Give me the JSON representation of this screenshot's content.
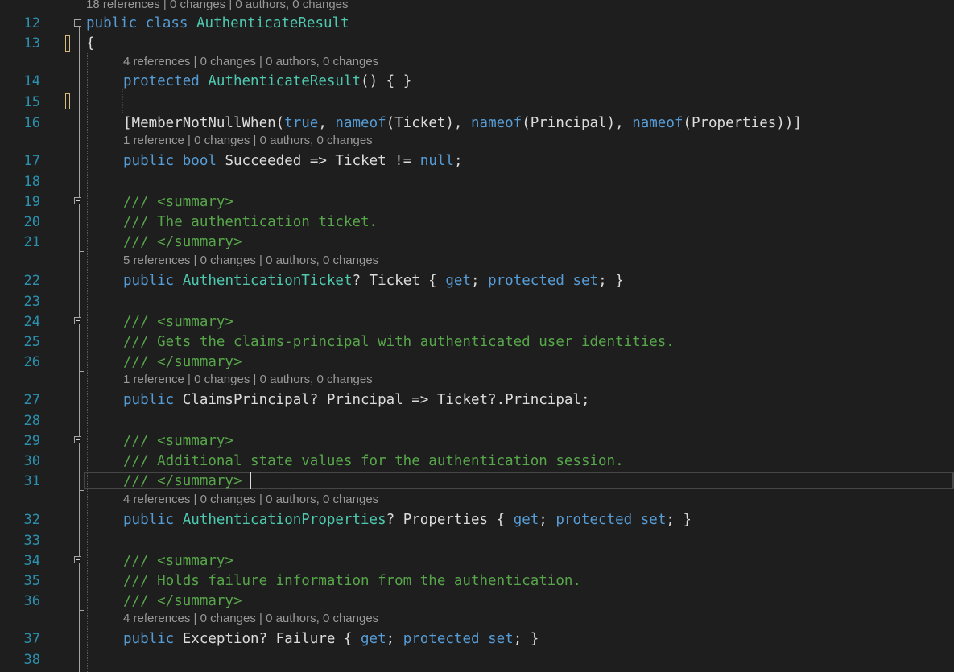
{
  "editor": {
    "lens_top": "18 references | 0 changes | 0 authors, 0 changes",
    "lines": [
      {
        "num": "12"
      },
      {
        "num": "13"
      },
      {
        "num": "14"
      },
      {
        "num": "15"
      },
      {
        "num": "16"
      },
      {
        "num": "17"
      },
      {
        "num": "18"
      },
      {
        "num": "19"
      },
      {
        "num": "20"
      },
      {
        "num": "21"
      },
      {
        "num": "22"
      },
      {
        "num": "23"
      },
      {
        "num": "24"
      },
      {
        "num": "25"
      },
      {
        "num": "26"
      },
      {
        "num": "27"
      },
      {
        "num": "28"
      },
      {
        "num": "29"
      },
      {
        "num": "30"
      },
      {
        "num": "31"
      },
      {
        "num": "32"
      },
      {
        "num": "33"
      },
      {
        "num": "34"
      },
      {
        "num": "35"
      },
      {
        "num": "36"
      },
      {
        "num": "37"
      },
      {
        "num": "38"
      }
    ],
    "lens": {
      "l14": "4 references | 0 changes | 0 authors, 0 changes",
      "l17": "1 reference | 0 changes | 0 authors, 0 changes",
      "l22": "5 references | 0 changes | 0 authors, 0 changes",
      "l27": "1 reference | 0 changes | 0 authors, 0 changes",
      "l32": "4 references | 0 changes | 0 authors, 0 changes",
      "l37": "4 references | 0 changes | 0 authors, 0 changes"
    },
    "code": {
      "l12": {
        "kw1": "public",
        "kw2": "class",
        "type": "AuthenticateResult"
      },
      "l13": {
        "brace": "{"
      },
      "l14": {
        "kw": "protected",
        "type": "AuthenticateResult",
        "rest": "() { }"
      },
      "l16": {
        "p1": "[MemberNotNullWhen(",
        "v1": "true",
        "p2": ", ",
        "k1": "nameof",
        "p3": "(Ticket), ",
        "k2": "nameof",
        "p4": "(Principal), ",
        "k3": "nameof",
        "p5": "(Properties))]"
      },
      "l17": {
        "k1": "public",
        "k2": "bool",
        "p1": " Succeeded => Ticket != ",
        "k3": "null",
        "p2": ";"
      },
      "l19": "/// <summary>",
      "l20": "/// The authentication ticket.",
      "l21": "/// </summary>",
      "l22": {
        "k1": "public",
        "t1": "AuthenticationTicket",
        "p1": "? Ticket { ",
        "k2": "get",
        "p2": "; ",
        "k3": "protected",
        "k4": "set",
        "p3": "; }"
      },
      "l24": "/// <summary>",
      "l25": "/// Gets the claims-principal with authenticated user identities.",
      "l26": "/// </summary>",
      "l27": {
        "k1": "public",
        "p1": " ClaimsPrincipal? Principal => Ticket?.Principal;"
      },
      "l29": "/// <summary>",
      "l30": "/// Additional state values for the authentication session.",
      "l31": "/// </summary>",
      "l32": {
        "k1": "public",
        "t1": "AuthenticationProperties",
        "p1": "? Properties { ",
        "k2": "get",
        "p2": "; ",
        "k3": "protected",
        "k4": "set",
        "p3": "; }"
      },
      "l34": "/// <summary>",
      "l35": "/// Holds failure information from the authentication.",
      "l36": "/// </summary>",
      "l37": {
        "k1": "public",
        "p1": " Exception? Failure { ",
        "k2": "get",
        "p2": "; ",
        "k3": "protected",
        "k4": "set",
        "p3": "; }"
      }
    },
    "colors": {
      "background": "#1e1e1e",
      "line_number": "#2b91af",
      "keyword": "#569cd6",
      "type": "#4ec9b0",
      "comment": "#57a64a",
      "text": "#dcdcdc",
      "codelens": "#999999",
      "change_marker": "#d7ba7d"
    }
  }
}
